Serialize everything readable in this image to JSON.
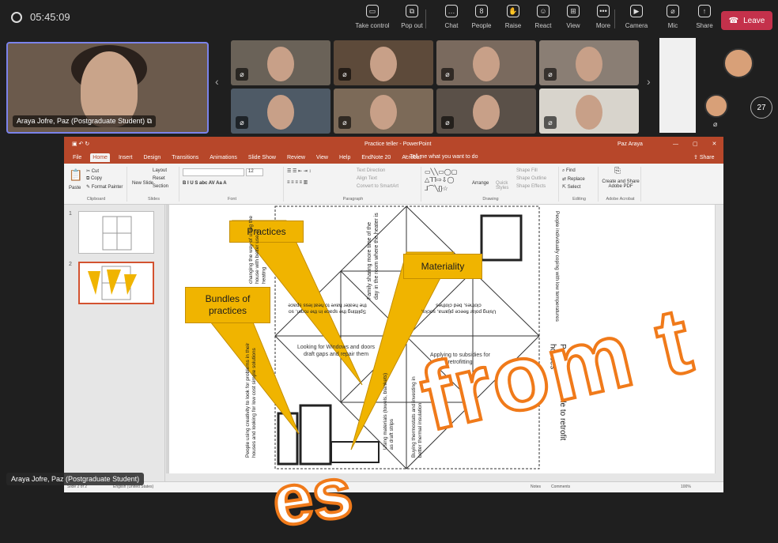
{
  "meeting": {
    "timer": "05:45:09",
    "toolbar": [
      {
        "label": "Take control",
        "icon": "take-control-icon",
        "glyph": "▭"
      },
      {
        "label": "Pop out",
        "icon": "pop-out-icon",
        "glyph": "⧉"
      },
      {
        "label": "Chat",
        "icon": "chat-icon",
        "glyph": "…"
      },
      {
        "label": "People",
        "icon": "people-icon",
        "glyph": "8"
      },
      {
        "label": "Raise",
        "icon": "raise-hand-icon",
        "glyph": "✋"
      },
      {
        "label": "React",
        "icon": "react-icon",
        "glyph": "☺"
      },
      {
        "label": "View",
        "icon": "view-icon",
        "glyph": "⊞"
      },
      {
        "label": "More",
        "icon": "more-icon",
        "glyph": "•••"
      },
      {
        "label": "Camera",
        "icon": "camera-off-icon",
        "glyph": "▶"
      },
      {
        "label": "Mic",
        "icon": "mic-off-icon",
        "glyph": "⌀"
      },
      {
        "label": "Share",
        "icon": "share-icon",
        "glyph": "↑"
      }
    ],
    "leave_label": "Leave",
    "self_name": "Araya Jofre, Paz (Postgraduate Student)",
    "participant_count": "27",
    "presenter_name": "Araya Jofre, Paz (Postgraduate Student)"
  },
  "ppt": {
    "window_title": "Practice teller - PowerPoint",
    "user": "Paz Araya",
    "share": "Share",
    "tabs": [
      "File",
      "Home",
      "Insert",
      "Design",
      "Transitions",
      "Animations",
      "Slide Show",
      "Review",
      "View",
      "Help",
      "EndNote 20",
      "Acrobat"
    ],
    "tellme": "Tell me what you want to do",
    "ribbon": {
      "cut": "Cut",
      "copy": "Copy",
      "paste": "Paste",
      "format_painter": "Format Painter",
      "clipboard": "Clipboard",
      "new_slide": "New Slide",
      "layout": "Layout",
      "reset": "Reset",
      "section": "Section",
      "slides": "Slides",
      "font": "Font",
      "font_size": "12",
      "paragraph": "Paragraph",
      "text_direction": "Text Direction",
      "align_text": "Align Text",
      "smartart": "Convert to SmartArt",
      "drawing": "Drawing",
      "arrange": "Arrange",
      "quick_styles": "Quick Styles",
      "shape_fill": "Shape Fill",
      "shape_outline": "Shape Outline",
      "shape_effects": "Shape Effects",
      "find": "Find",
      "replace": "Replace",
      "select": "Select",
      "editing": "Editing",
      "create_share": "Create and Share Adobe PDF",
      "adobe": "Adobe Acrobat"
    },
    "status": {
      "slide": "Slide 2 of 2",
      "lang": "English (United States)",
      "notes": "Notes",
      "comments": "Comments",
      "zoom": "100%"
    }
  },
  "slide": {
    "callouts": {
      "practices": "Practices",
      "materiality": "Materiality",
      "bundles": "Bundles of practices"
    },
    "texts": {
      "top_right": "People individually coping with low temperatures",
      "family": "Family sharing more time of the day in the room where the heater is",
      "polar": "Using polar fleece pijama, socks, clothes, bed clothes",
      "splitting": "Splitting the space in the room, so the heater have to heat less space",
      "looking": "Looking for Windows and doors draft gaps and repair them",
      "applying": "Applying to subsidies for retrofitting",
      "retrofit": "People being able to retrofit houses",
      "creativity": "People using creativity to look for problems in their houses and looking for low cost simple solutions",
      "left_top": "changing the way of using the house with better use of heating",
      "materials": "Using materials (towels, blankets) as draft strips",
      "thermo": "Buying thermostats and investing in better thermal insulation"
    }
  },
  "overlay": {
    "line1": "from t",
    "line2": "es"
  }
}
